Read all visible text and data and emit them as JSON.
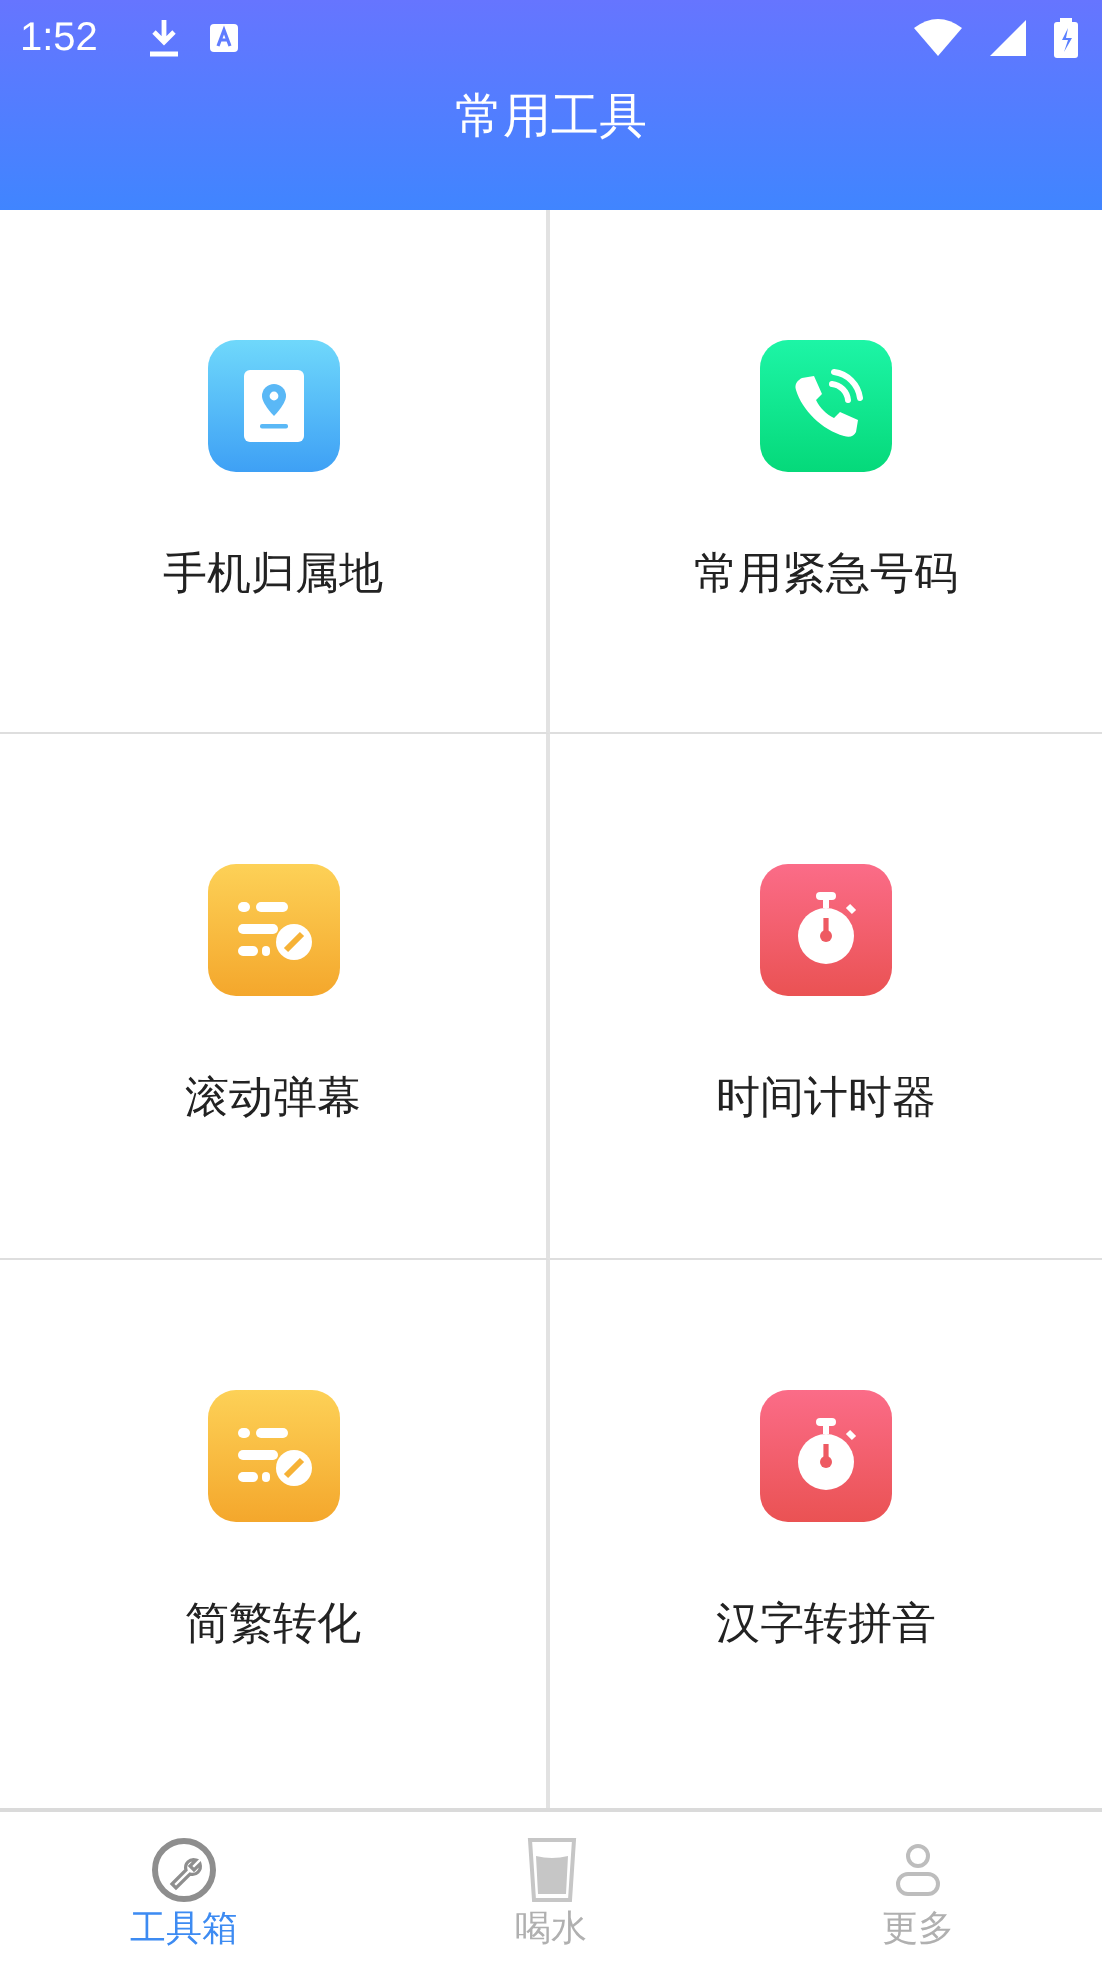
{
  "status_bar": {
    "time": "1:52"
  },
  "header": {
    "title": "常用工具"
  },
  "tools": [
    {
      "label": "手机归属地",
      "kind": "location"
    },
    {
      "label": "常用紧急号码",
      "kind": "phone"
    },
    {
      "label": "滚动弹幕",
      "kind": "danmaku"
    },
    {
      "label": "时间计时器",
      "kind": "timer"
    },
    {
      "label": "简繁转化",
      "kind": "danmaku"
    },
    {
      "label": "汉字转拼音",
      "kind": "timer"
    }
  ],
  "bottom_nav": [
    {
      "label": "工具箱",
      "kind": "toolbox",
      "selected": true
    },
    {
      "label": "喝水",
      "kind": "water",
      "selected": false
    },
    {
      "label": "更多",
      "kind": "profile",
      "selected": false
    }
  ]
}
